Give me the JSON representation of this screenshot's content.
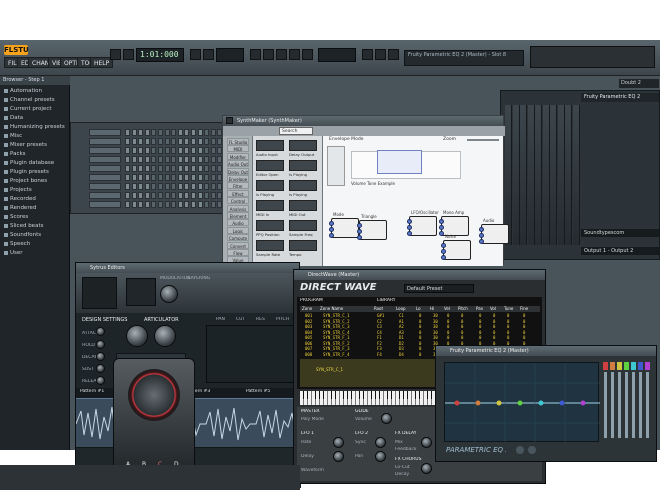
{
  "topbar": {
    "app_logo": "FLSTUDIO",
    "menu": [
      "FILE",
      "EDIT",
      "CHANNELS",
      "VIEW",
      "OPTIONS",
      "TOOLS",
      "HELP"
    ],
    "time_display": "1:01:000",
    "hint_text": "Fruity Parametric EQ 2 (Master) - Slot 8"
  },
  "browser": {
    "title": "Browser - Step 1",
    "items": [
      "Automation",
      "Channel presets",
      "Current project",
      "Data",
      "Humanizing presets",
      "Misc",
      "Mixer presets",
      "Packs",
      "Plugin database",
      "Plugin presets",
      "Project bones",
      "Projects",
      "Recorded",
      "Rendered",
      "Scores",
      "Sliced beats",
      "Soundfonts",
      "Speech",
      "User"
    ]
  },
  "synthmaker": {
    "title": "SynthMaker (SynthMaker)",
    "search_label": "Search",
    "sidebar": [
      "FL Studio",
      "MIDI",
      "Modifier",
      "Audio Output",
      "Delay Output",
      "Envelope",
      "Filter",
      "Effect",
      "Control",
      "Analysis",
      "Element",
      "Audio",
      "Logic",
      "Compute",
      "Convert",
      "Flow",
      "Value",
      "Text",
      "Array"
    ],
    "node_titles": [
      "Envelope Mode",
      "Zoom",
      "Volume Tone Example",
      "Mode",
      "Mono Amp",
      "Noise",
      "Triangle",
      "LFO/Oscillator",
      "Audio"
    ],
    "toolbar_labels": [
      "Audio Input",
      "Delay Output",
      "Editor Open",
      "Is Playing",
      "Is Playing",
      "Is Playing",
      "MIDI In",
      "MIDI Out",
      "PPQ Position",
      "Sample Freq",
      "Sample Rate",
      "Tempo"
    ]
  },
  "sytrus": {
    "title": "Sytrus Editors",
    "sections": [
      "MODULATION",
      "LAYERING",
      "DESIGN SETTINGS",
      "ARTICULATOR",
      "PAN",
      "CUT",
      "RES",
      "PITCH"
    ],
    "knob_labels": [
      "ATTACK",
      "HOLD",
      "DECAY",
      "SUST",
      "RELEASE",
      "MOD X",
      "MOD Y"
    ],
    "pad_labels": [
      "Pattern #1",
      "Pattern #3",
      "Pattern #5"
    ],
    "letters": [
      "A",
      "B",
      "C",
      "D"
    ]
  },
  "directwave": {
    "title": "DirectWave (Master)",
    "brand": "DIRECT WAVE",
    "program_label": "PROGRAM",
    "library_label": "LIBRARY",
    "program_name": "Default Preset",
    "columns": [
      "Zone",
      "Zone Name",
      "Root",
      "Loop",
      "Lo",
      "Hi",
      "Vel",
      "Pitch",
      "Pan",
      "Vol",
      "Tune",
      "Fine"
    ],
    "zones": [
      [
        "001",
        "SYN_STR_C_1",
        "G#1",
        "C1",
        "0",
        "30",
        "0",
        "0",
        "0",
        "0",
        "0",
        "0"
      ],
      [
        "002",
        "SYN_STR_C_2",
        "C2",
        "A1",
        "0",
        "30",
        "0",
        "0",
        "0",
        "0",
        "0",
        "0"
      ],
      [
        "003",
        "SYN_STR_C_3",
        "C3",
        "A2",
        "0",
        "30",
        "0",
        "0",
        "0",
        "0",
        "0",
        "0"
      ],
      [
        "004",
        "SYN_STR_C_4",
        "C4",
        "A3",
        "0",
        "30",
        "0",
        "0",
        "0",
        "0",
        "0",
        "0"
      ],
      [
        "005",
        "SYN_STR_F_1",
        "F1",
        "D1",
        "0",
        "30",
        "0",
        "0",
        "0",
        "0",
        "0",
        "0"
      ],
      [
        "006",
        "SYN_STR_F_2",
        "F2",
        "D2",
        "0",
        "30",
        "0",
        "0",
        "0",
        "0",
        "0",
        "0"
      ],
      [
        "007",
        "SYN_STR_F_3",
        "F3",
        "D3",
        "0",
        "30",
        "0",
        "0",
        "0",
        "0",
        "0",
        "0"
      ],
      [
        "008",
        "SYN_STR_F_4",
        "F4",
        "D4",
        "0",
        "30",
        "0",
        "0",
        "0",
        "0",
        "0",
        "0"
      ]
    ],
    "zone_label": "SYN_STR_C_1",
    "sections": [
      "MASTER",
      "GLIDE",
      "LFO 1",
      "LFO 2",
      "FX DELAY",
      "FX CHORUS"
    ],
    "params": [
      "Poly Mode",
      "Volume",
      "Pan",
      "Delay",
      "Mix",
      "Rate",
      "Feedback",
      "Waveform",
      "Decay",
      "Lo-Cut",
      "Sync"
    ]
  },
  "parametric_eq": {
    "title": "Fruity Parametric EQ 2 (Master)",
    "brand": "PARAMETRIC EQ 2",
    "bands": 7,
    "band_colors": [
      "#d04040",
      "#d07d40",
      "#d0c540",
      "#5fd040",
      "#40c8d0",
      "#4058d0",
      "#b040d0"
    ]
  },
  "mixer": {
    "title": "Fruity Parametric EQ 2",
    "preset": "Doubt 2",
    "output": "Output 1 - Output 2",
    "send": "Soundtypescom"
  }
}
